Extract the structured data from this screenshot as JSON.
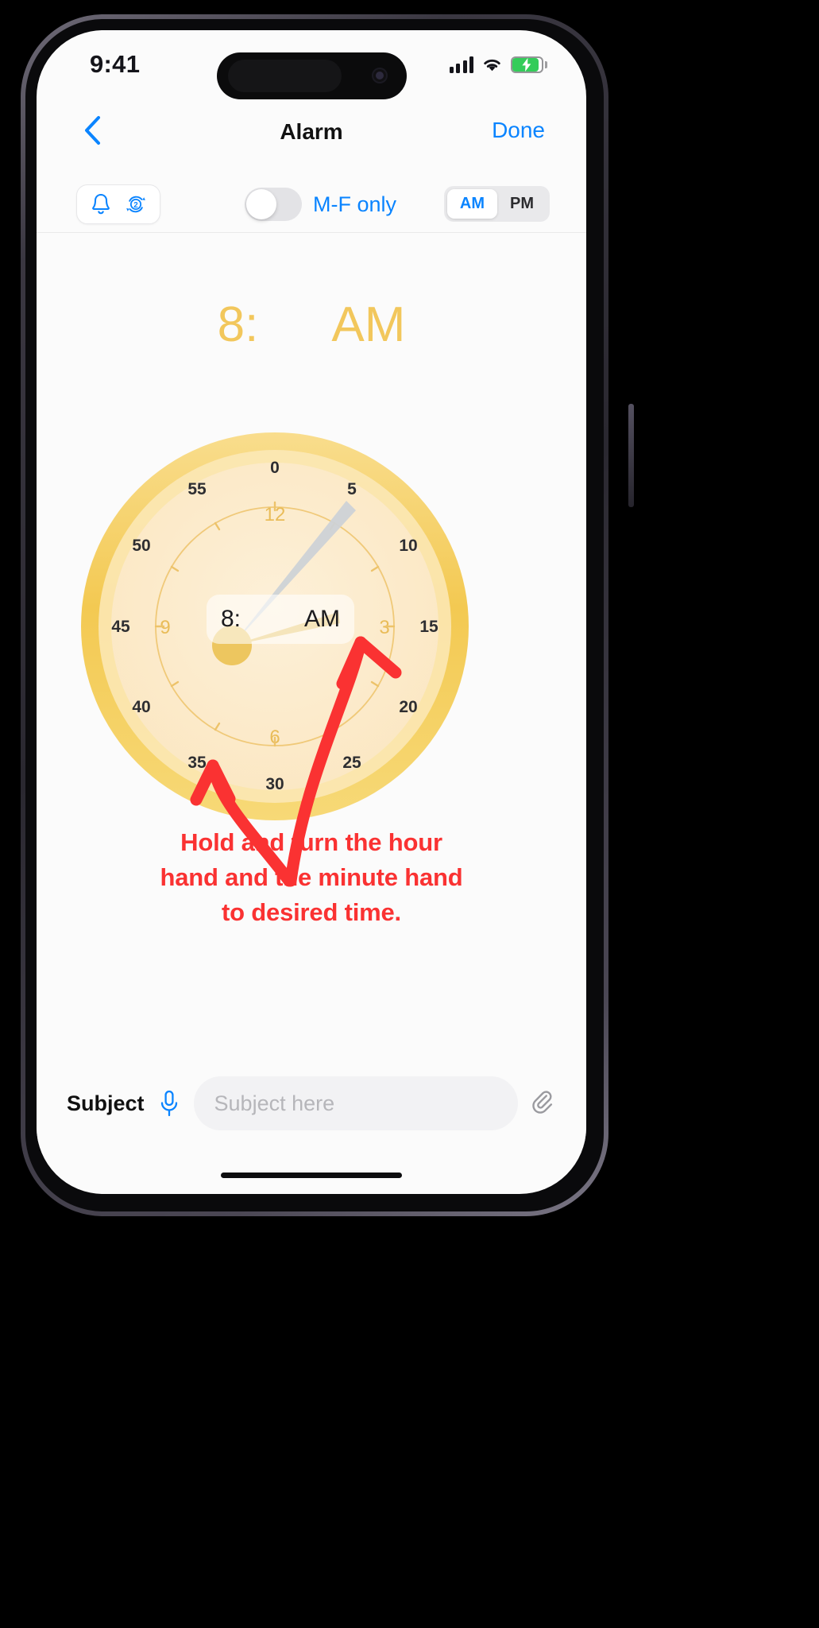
{
  "status_bar": {
    "time": "9:41",
    "signal_icon": "cellular-signal-icon",
    "wifi_icon": "wifi-icon",
    "battery_icon": "battery-charging-icon"
  },
  "nav": {
    "back_icon": "chevron-left-icon",
    "title": "Alarm",
    "done_label": "Done"
  },
  "toolbar": {
    "bell_icon": "bell-icon",
    "repeat_icon": "repeat-2-icon",
    "repeat_count": "2",
    "toggle_state": "off",
    "toggle_label": "M-F only",
    "am_label": "AM",
    "pm_label": "PM",
    "selected_meridiem": "AM"
  },
  "big_time": {
    "hour": "8:",
    "minute": "",
    "meridiem": "AM",
    "color": "#f2c75c"
  },
  "clock": {
    "center_hour": "8:",
    "center_meridiem": "AM",
    "minute_ticks": [
      "0",
      "5",
      "10",
      "15",
      "20",
      "25",
      "30",
      "35",
      "40",
      "45",
      "50",
      "55"
    ],
    "hour_marks": [
      "12",
      "3",
      "6",
      "9"
    ],
    "hour_hand_angle_deg": 250,
    "minute_hand_angle_deg": 28,
    "bezel_color": "#f5d06a",
    "face_color": "#fdeccc",
    "hour_hand_color": "#e8c05e",
    "minute_hand_color": "#ced2d6"
  },
  "annotation": {
    "line1": "Hold and turn the hour",
    "line2": "hand and the minute hand",
    "line3": "to desired time.",
    "color": "#fa3232",
    "arrow_count": 2
  },
  "subject_bar": {
    "label": "Subject",
    "mic_icon": "microphone-icon",
    "input_value": "",
    "input_placeholder": "Subject here",
    "attach_icon": "paperclip-icon"
  }
}
